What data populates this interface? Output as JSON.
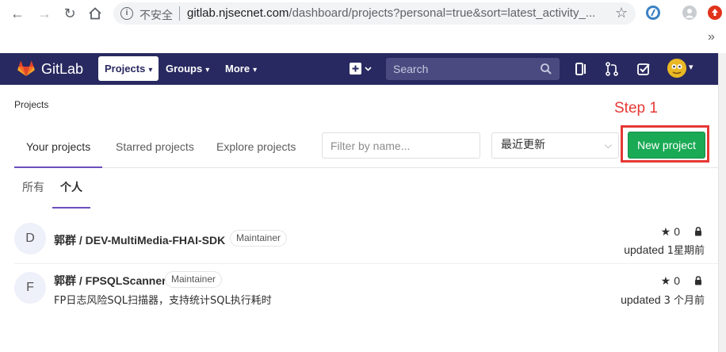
{
  "browser": {
    "insecure_label": "不安全",
    "url_host": "gitlab.njsecnet.com",
    "url_rest": "/dashboard/projects?personal=true&sort=latest_activity_...",
    "bookmarks_more": "»"
  },
  "navbar": {
    "brand": "GitLab",
    "menu": [
      {
        "label": "Projects",
        "active": true
      },
      {
        "label": "Groups",
        "active": false
      },
      {
        "label": "More",
        "active": false
      }
    ],
    "search_placeholder": "Search",
    "colors": {
      "background": "#292961",
      "search_bg": "#4a4a80"
    }
  },
  "page": {
    "breadcrumb": "Projects",
    "annotation": "Step 1",
    "tabs": [
      {
        "label": "Your projects",
        "active": true
      },
      {
        "label": "Starred projects",
        "active": false
      },
      {
        "label": "Explore projects",
        "active": false
      }
    ],
    "filter_placeholder": "Filter by name...",
    "sort_value": "最近更新",
    "new_project_label": "New project",
    "subtabs": [
      {
        "label": "所有",
        "active": false
      },
      {
        "label": "个人",
        "active": true
      }
    ]
  },
  "projects": [
    {
      "avatar_letter": "D",
      "namespace": "郭群",
      "name": "DEV-MultiMedia-FHAI-SDK",
      "role": "Maintainer",
      "description": "",
      "stars": "0",
      "updated_prefix": "updated",
      "updated_time": "1星期前"
    },
    {
      "avatar_letter": "F",
      "namespace": "郭群",
      "name": "FPSQLScanner",
      "role": "Maintainer",
      "description": "FP日志风险SQL扫描器，支持统计SQL执行耗时",
      "stars": "0",
      "updated_prefix": "updated",
      "updated_time": "3 个月前"
    }
  ],
  "colors": {
    "accent_green": "#1aaa55",
    "annotation_red": "#e53935",
    "tab_underline": "#6b4fbb"
  }
}
